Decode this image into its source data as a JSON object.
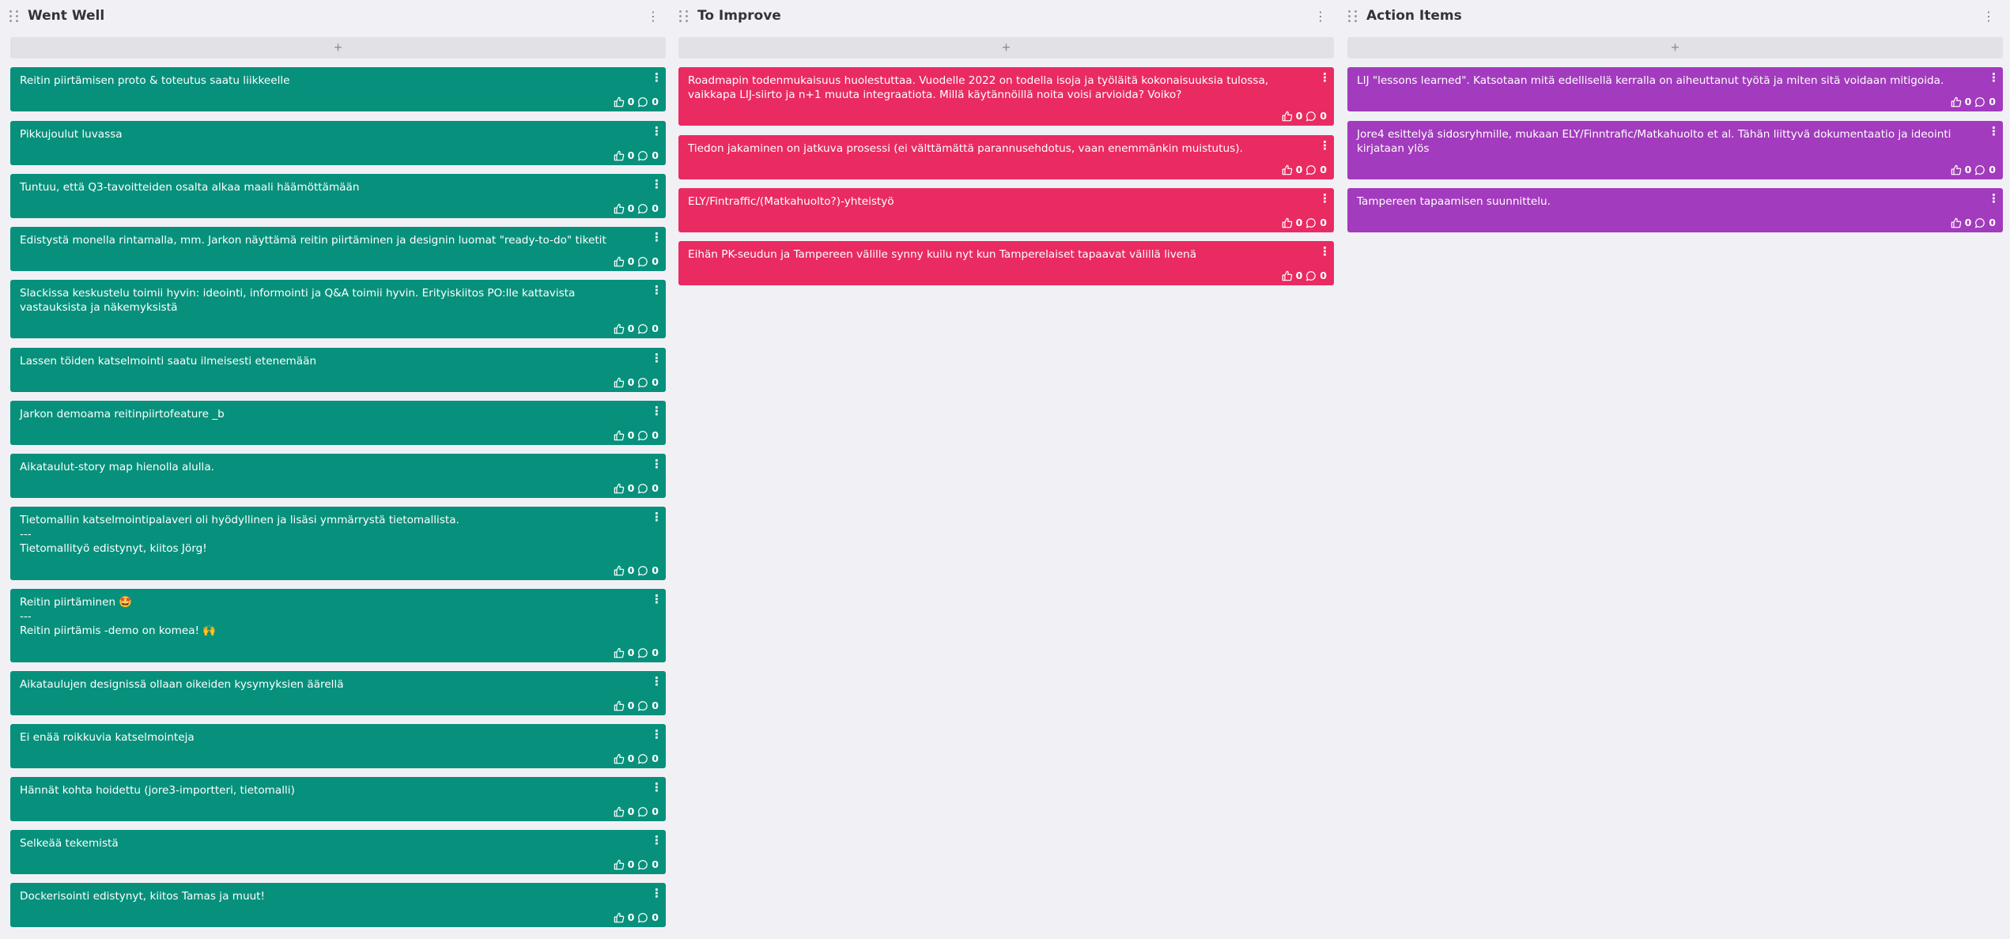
{
  "columns": [
    {
      "title": "Went Well",
      "add_label": "+",
      "color": "#07917c",
      "cards": [
        {
          "lines": [
            "Reitin piirtämisen proto & toteutus saatu liikkeelle"
          ],
          "likes": "0",
          "comments": "0"
        },
        {
          "lines": [
            "Pikkujoulut luvassa"
          ],
          "likes": "0",
          "comments": "0"
        },
        {
          "lines": [
            "Tuntuu, että Q3-tavoitteiden osalta alkaa maali häämöttämään"
          ],
          "likes": "0",
          "comments": "0"
        },
        {
          "lines": [
            "Edistystä monella rintamalla, mm. Jarkon näyttämä reitin piirtäminen ja designin luomat \"ready-to-do\" tiketit"
          ],
          "likes": "0",
          "comments": "0"
        },
        {
          "lines": [
            "Slackissa keskustelu toimii hyvin: ideointi, informointi ja Q&A toimii hyvin. Erityiskiitos PO:lle kattavista vastauksista ja näkemyksistä"
          ],
          "likes": "0",
          "comments": "0"
        },
        {
          "lines": [
            "Lassen töiden katselmointi saatu ilmeisesti etenemään"
          ],
          "likes": "0",
          "comments": "0"
        },
        {
          "lines": [
            "Jarkon demoama reitinpiirtofeature _b"
          ],
          "likes": "0",
          "comments": "0"
        },
        {
          "lines": [
            "Aikataulut-story map hienolla alulla."
          ],
          "likes": "0",
          "comments": "0"
        },
        {
          "lines": [
            "Tietomallin katselmointipalaveri oli hyödyllinen ja lisäsi ymmärrystä tietomallista.",
            "---",
            "Tietomallityö edistynyt, kiitos Jörg!"
          ],
          "likes": "0",
          "comments": "0"
        },
        {
          "lines": [
            "Reitin piirtäminen 🤩",
            "---",
            "Reitin piirtämis -demo on komea! 🙌"
          ],
          "likes": "0",
          "comments": "0"
        },
        {
          "lines": [
            "Aikataulujen designissä ollaan oikeiden kysymyksien äärellä"
          ],
          "likes": "0",
          "comments": "0"
        },
        {
          "lines": [
            "Ei enää roikkuvia katselmointeja"
          ],
          "likes": "0",
          "comments": "0"
        },
        {
          "lines": [
            "Hännät kohta hoidettu (jore3-importteri, tietomalli)"
          ],
          "likes": "0",
          "comments": "0"
        },
        {
          "lines": [
            "Selkeää tekemistä"
          ],
          "likes": "0",
          "comments": "0"
        },
        {
          "lines": [
            "Dockerisointi edistynyt, kiitos Tamas ja muut!"
          ],
          "likes": "0",
          "comments": "0"
        }
      ]
    },
    {
      "title": "To Improve",
      "add_label": "+",
      "color": "#e92b62",
      "cards": [
        {
          "lines": [
            "Roadmapin todenmukaisuus huolestuttaa. Vuodelle 2022 on todella isoja ja työläitä kokonaisuuksia tulossa, vaikkapa LIJ-siirto ja n+1 muuta integraatiota. Millä käytännöillä noita voisi arvioida? Voiko?"
          ],
          "likes": "0",
          "comments": "0"
        },
        {
          "lines": [
            "Tiedon jakaminen on jatkuva prosessi (ei välttämättä parannusehdotus, vaan enemmänkin muistutus)."
          ],
          "likes": "0",
          "comments": "0"
        },
        {
          "lines": [
            "ELY/Fintraffic/(Matkahuolto?)-yhteistyö"
          ],
          "likes": "0",
          "comments": "0"
        },
        {
          "lines": [
            "Eihän PK-seudun ja Tampereen välille synny kuilu nyt kun Tamperelaiset tapaavat välillä livenä"
          ],
          "likes": "0",
          "comments": "0"
        }
      ]
    },
    {
      "title": "Action Items",
      "add_label": "+",
      "color": "#a23bbd",
      "cards": [
        {
          "lines": [
            "LIJ \"lessons learned\". Katsotaan mitä edellisellä kerralla on aiheuttanut työtä ja miten sitä voidaan mitigoida."
          ],
          "likes": "0",
          "comments": "0"
        },
        {
          "lines": [
            "Jore4 esittelyä sidosryhmille, mukaan ELY/Finntrafic/Matkahuolto et al. Tähän liittyvä dokumentaatio ja ideointi kirjataan ylös"
          ],
          "likes": "0",
          "comments": "0"
        },
        {
          "lines": [
            "Tampereen tapaamisen suunnittelu."
          ],
          "likes": "0",
          "comments": "0"
        }
      ]
    }
  ]
}
